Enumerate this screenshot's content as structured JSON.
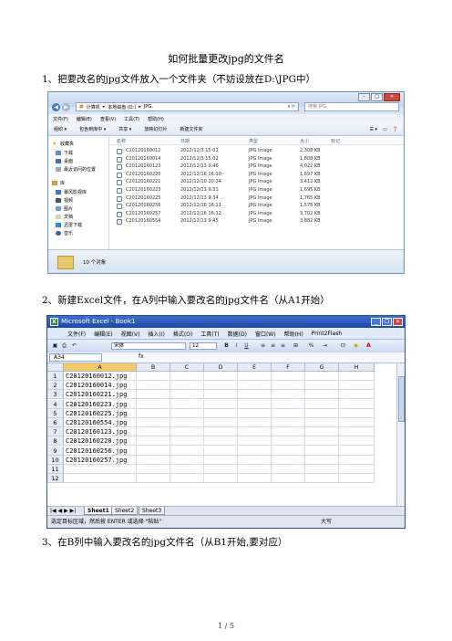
{
  "document": {
    "title": "如何批量更改jpg的文件名",
    "step1": "1、把要改名的jpg文件放入一个文件夹（不妨设放在D:\\JPG中）",
    "step2": "2、新建Excel文件，在A列中输入要改名的jpg文件名（从A1开始）",
    "step3": "3、在B列中输入要改名的jpg文件名（从B1开始,要对应）",
    "page_number": "1 / 5"
  },
  "explorer": {
    "path": [
      "计算机",
      "本地磁盘 (D:)",
      "JPG"
    ],
    "search_placeholder": "搜索 JPG",
    "menu": [
      "文件(F)",
      "编辑(E)",
      "查看(V)",
      "工具(T)",
      "帮助(H)"
    ],
    "toolbar": [
      "组织 ▾",
      "包含到库中 ▾",
      "共享 ▾",
      "放映幻灯片",
      "新建文件夹"
    ],
    "sidebar": {
      "favorites_header": "收藏夹",
      "favorites": [
        "下载",
        "桌面",
        "最近访问的位置"
      ],
      "libraries_header": "库",
      "libraries": [
        "暴风影视库",
        "视频",
        "图片",
        "文档",
        "迅雷下载",
        "音乐"
      ]
    },
    "columns": {
      "name": "名称",
      "date": "日期",
      "type": "类型",
      "size": "大小",
      "tags": "标记"
    },
    "files": [
      {
        "name": "C20120160012",
        "date": "2012/12/3 15:01",
        "type": "JPG Image",
        "size": "2,308 KB"
      },
      {
        "name": "C20120160014",
        "date": "2012/12/3 15:02",
        "type": "JPG Image",
        "size": "1,808 KB"
      },
      {
        "name": "C20120160123",
        "date": "2012/12/13 9:46",
        "type": "JPG Image",
        "size": "4,022 KB"
      },
      {
        "name": "C20120160220",
        "date": "2012/12/16 16:10",
        "type": "JPG Image",
        "size": "1,697 KB"
      },
      {
        "name": "C20120160221",
        "date": "2012/12/10 20:34",
        "type": "JPG Image",
        "size": "3,412 KB"
      },
      {
        "name": "C20120160223",
        "date": "2012/12/13 9:31",
        "type": "JPG Image",
        "size": "1,695 KB"
      },
      {
        "name": "C20120160225",
        "date": "2012/12/13 9:34",
        "type": "JPG Image",
        "size": "1,765 KB"
      },
      {
        "name": "C20120160256",
        "date": "2012/12/16 16:11",
        "type": "JPG Image",
        "size": "1,578 KB"
      },
      {
        "name": "C20120160257",
        "date": "2012/12/16 16:12",
        "type": "JPG Image",
        "size": "3,702 KB"
      },
      {
        "name": "C20120160554",
        "date": "2012/12/13 9:45",
        "type": "JPG Image",
        "size": "3,882 KB"
      }
    ],
    "status": "10 个对象"
  },
  "excel": {
    "title": "Microsoft Excel - Book1",
    "menu": [
      "文件(F)",
      "编辑(E)",
      "视图(V)",
      "插入(I)",
      "格式(O)",
      "工具(T)",
      "数据(D)",
      "窗口(W)",
      "帮助(H)",
      "Print2Flash"
    ],
    "font_name": "宋体",
    "font_size": "12",
    "name_box": "A34",
    "fx": "fx",
    "columns": [
      "A",
      "B",
      "C",
      "D",
      "E",
      "F",
      "G",
      "H"
    ],
    "rows": [
      "1",
      "2",
      "3",
      "4",
      "5",
      "6",
      "7",
      "8",
      "9",
      "10",
      "11",
      "12"
    ],
    "cells_a": [
      "C20120160012.jpg",
      "C20120160014.jpg",
      "C20120160221.jpg",
      "C20120160223.jpg",
      "C20120160225.jpg",
      "C20120160554.jpg",
      "C20120160123.jpg",
      "C20120160220.jpg",
      "C20120160256.jpg",
      "C20120160257.jpg",
      "",
      ""
    ],
    "sheets": [
      "Sheet1",
      "Sheet2",
      "Sheet3"
    ],
    "status_left": "选定目标区域，然后按 ENTER 或选择 \"粘贴\"",
    "status_right": "大写"
  }
}
